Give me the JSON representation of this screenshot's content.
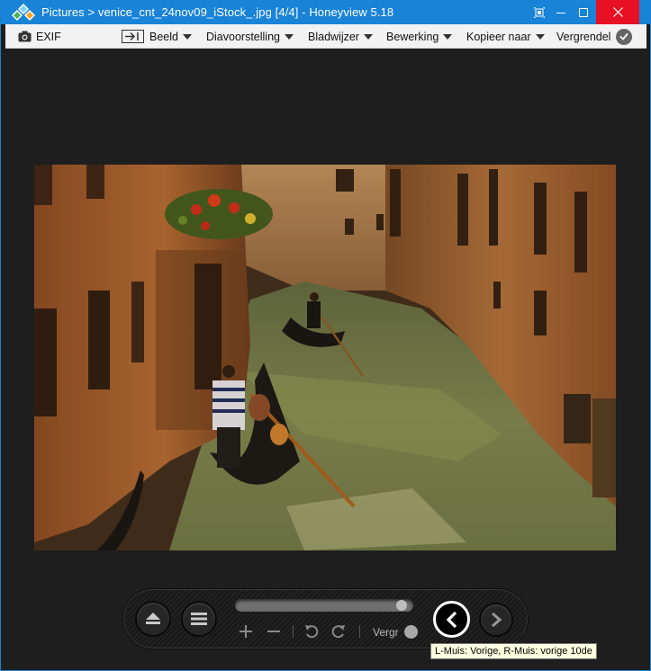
{
  "titlebar": {
    "title": "Pictures > venice_cnt_24nov09_iStock_.jpg [4/4] - Honeyview 5.18",
    "icon": "honeyview-app-icon",
    "buttons": [
      "fit-window-icon",
      "minimize-icon",
      "maximize-icon",
      "close-icon"
    ]
  },
  "toolbar": {
    "exif": "EXIF",
    "beeld": "Beeld",
    "diavoorstelling": "Diavoorstelling",
    "bladwijzer": "Bladwijzer",
    "bewerking": "Bewerking",
    "kopieer": "Kopieer naar",
    "vergrendel": "Vergrendel"
  },
  "image": {
    "subject": "venice-canal-gondolas"
  },
  "controls": {
    "slider_position": 0.97,
    "vergr_label": "Vergr",
    "tooltip": "L-Muis: Vorige, R-Muis: vorige 10de"
  },
  "colors": {
    "titlebar": "#1883d7",
    "close": "#e81123",
    "background": "#1e1e1e",
    "toolbar": "#f2f2f2",
    "tooltip": "#ffffe1"
  }
}
